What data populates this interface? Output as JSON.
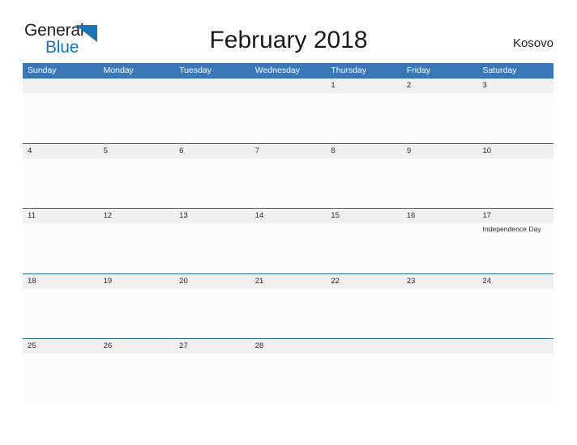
{
  "brand": {
    "name_part1": "General",
    "name_part2": "Blue",
    "triangle_icon": "blue-triangle-icon",
    "color_dark": "#231f20",
    "color_blue": "#1a74b8"
  },
  "header": {
    "title": "February 2018",
    "country": "Kosovo"
  },
  "theme": {
    "header_bar": "#3a77b8",
    "row_rule": "#2c6aa8",
    "date_band": "#efefef",
    "cell_body": "#fcfcfc",
    "text": "#2b2b2b",
    "header_text": "#ffffff"
  },
  "calendar": {
    "month": "February",
    "year": "2018",
    "weekdays": [
      "Sunday",
      "Monday",
      "Tuesday",
      "Wednesday",
      "Thursday",
      "Friday",
      "Saturday"
    ],
    "weeks": [
      {
        "days": [
          {
            "date": "",
            "event": ""
          },
          {
            "date": "",
            "event": ""
          },
          {
            "date": "",
            "event": ""
          },
          {
            "date": "",
            "event": ""
          },
          {
            "date": "1",
            "event": ""
          },
          {
            "date": "2",
            "event": ""
          },
          {
            "date": "3",
            "event": ""
          }
        ]
      },
      {
        "days": [
          {
            "date": "4",
            "event": ""
          },
          {
            "date": "5",
            "event": ""
          },
          {
            "date": "6",
            "event": ""
          },
          {
            "date": "7",
            "event": ""
          },
          {
            "date": "8",
            "event": ""
          },
          {
            "date": "9",
            "event": ""
          },
          {
            "date": "10",
            "event": ""
          }
        ]
      },
      {
        "days": [
          {
            "date": "11",
            "event": ""
          },
          {
            "date": "12",
            "event": ""
          },
          {
            "date": "13",
            "event": ""
          },
          {
            "date": "14",
            "event": ""
          },
          {
            "date": "15",
            "event": ""
          },
          {
            "date": "16",
            "event": ""
          },
          {
            "date": "17",
            "event": "Independence Day"
          }
        ]
      },
      {
        "days": [
          {
            "date": "18",
            "event": ""
          },
          {
            "date": "19",
            "event": ""
          },
          {
            "date": "20",
            "event": ""
          },
          {
            "date": "21",
            "event": ""
          },
          {
            "date": "22",
            "event": ""
          },
          {
            "date": "23",
            "event": ""
          },
          {
            "date": "24",
            "event": ""
          }
        ]
      },
      {
        "days": [
          {
            "date": "25",
            "event": ""
          },
          {
            "date": "26",
            "event": ""
          },
          {
            "date": "27",
            "event": ""
          },
          {
            "date": "28",
            "event": ""
          },
          {
            "date": "",
            "event": ""
          },
          {
            "date": "",
            "event": ""
          },
          {
            "date": "",
            "event": ""
          }
        ]
      }
    ]
  }
}
